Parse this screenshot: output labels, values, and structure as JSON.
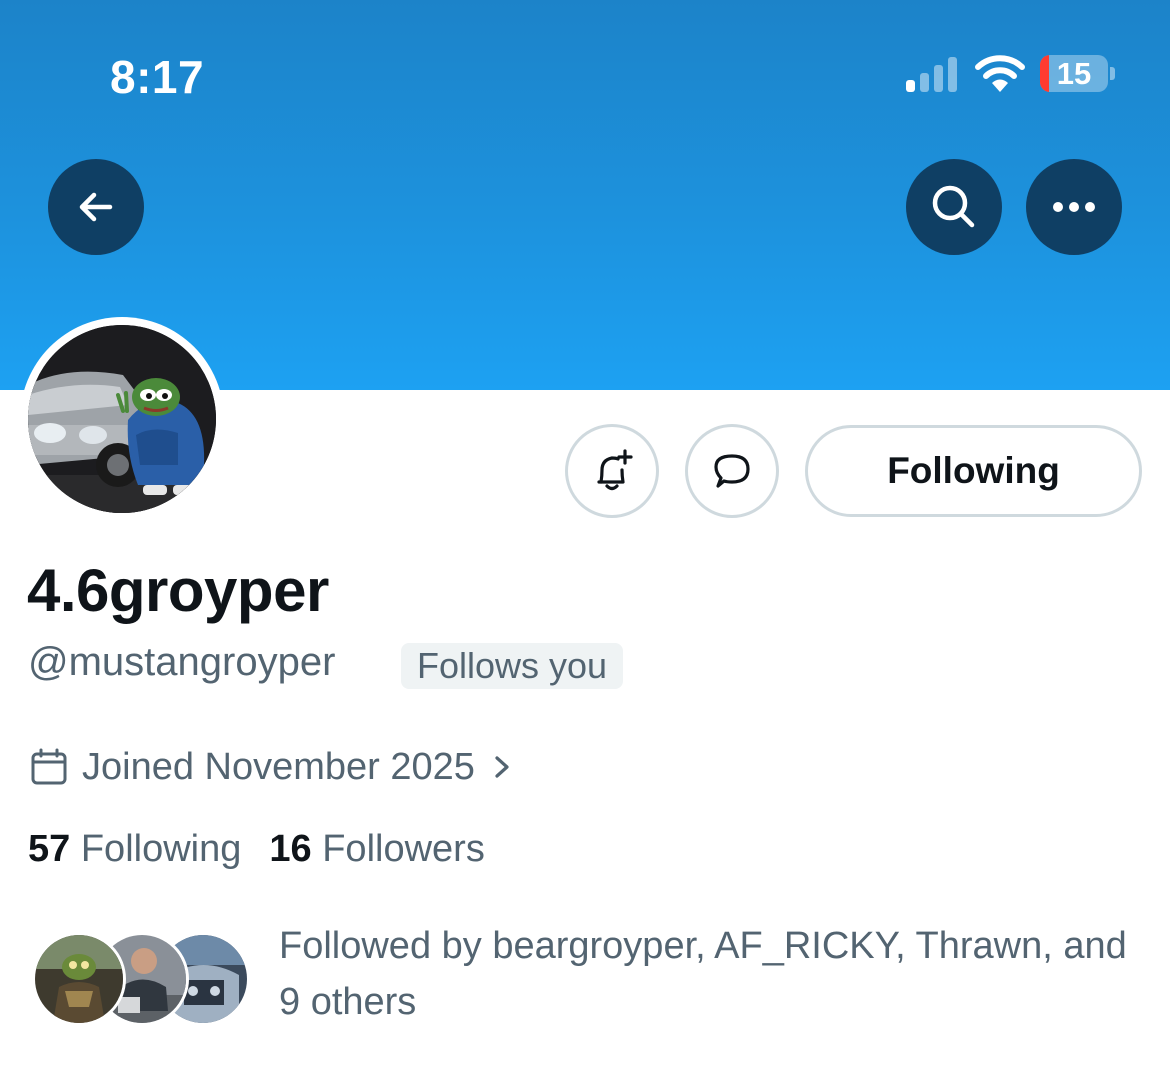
{
  "status_bar": {
    "time": "8:17",
    "battery_percent": "15",
    "signal_bars_on": 1
  },
  "header": {
    "back_icon": "arrow-left-icon",
    "search_icon": "search-icon",
    "more_icon": "more-horizontal-icon",
    "banner_color": "#1da1f2"
  },
  "profile": {
    "display_name": "4.6groyper",
    "handle": "@mustangroyper",
    "follows_you_badge": "Follows you",
    "joined": "Joined November 2025",
    "following_count": "57",
    "following_label": "Following",
    "followers_count": "16",
    "followers_label": "Followers",
    "followed_by_prefix": "Followed by ",
    "followed_by_names": "beargroyper, AF_RICKY, Thrawn, and",
    "followed_by_others": "9 others"
  },
  "actions": {
    "notify_icon": "bell-plus-icon",
    "message_icon": "message-bubble-icon",
    "following_button": "Following"
  }
}
